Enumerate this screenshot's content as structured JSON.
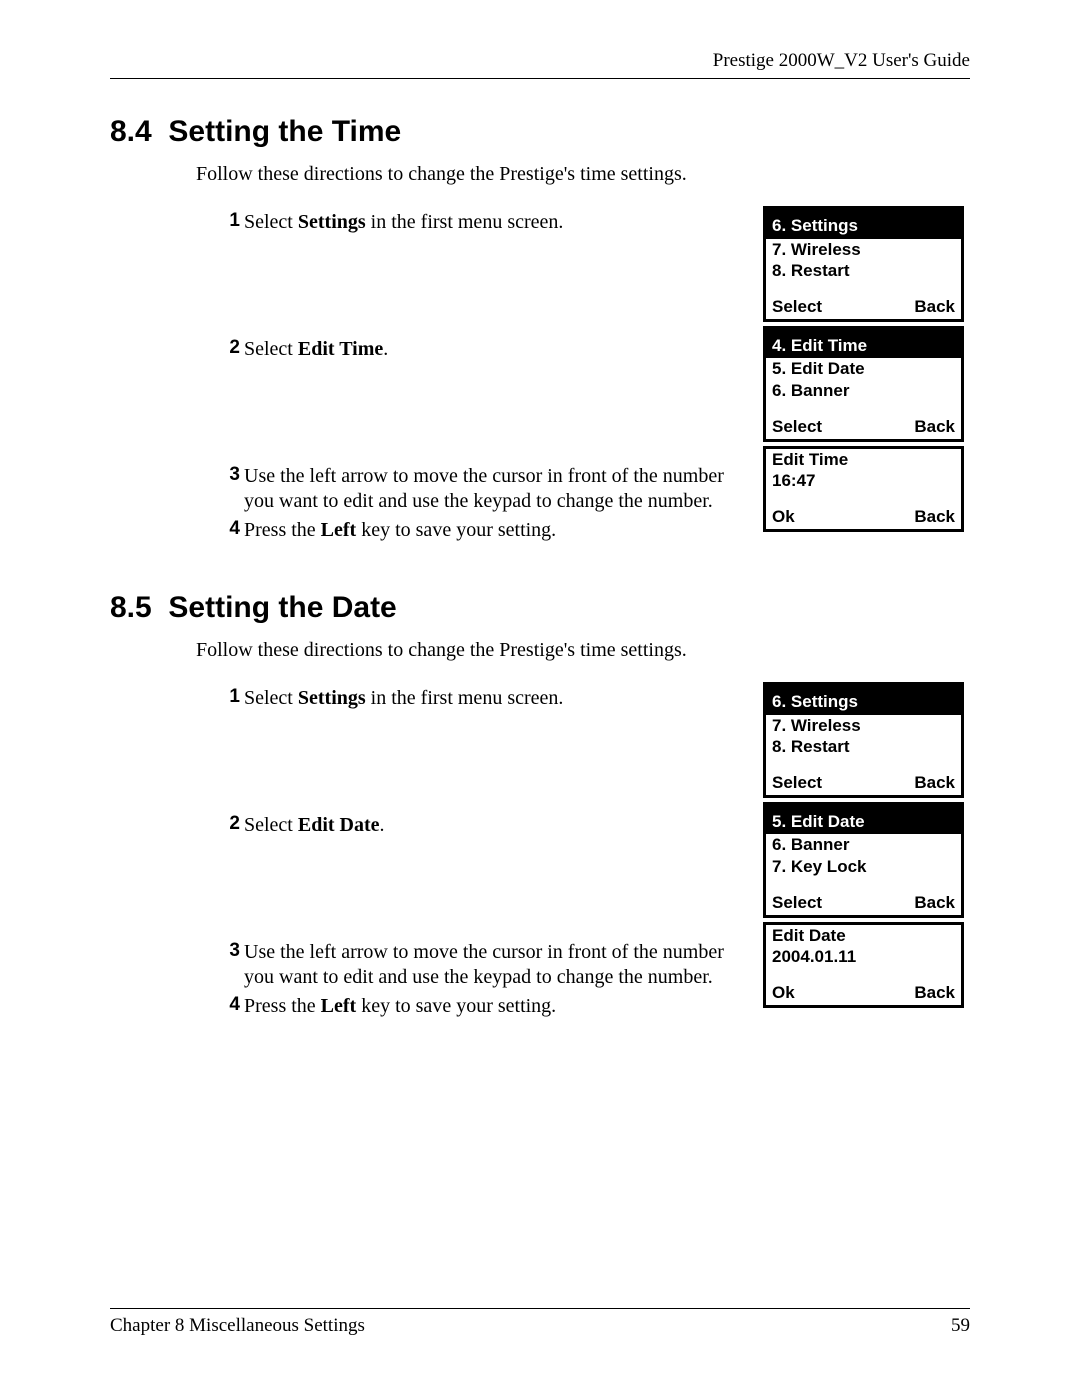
{
  "header": {
    "doc_title": "Prestige 2000W_V2 User's Guide"
  },
  "section_a": {
    "number": "8.4",
    "title": "Setting the Time",
    "intro": "Follow these directions to change the Prestige's time settings.",
    "steps": {
      "n1": "1",
      "s1_pre": "Select ",
      "s1_bold": "Settings",
      "s1_post": " in the first menu screen.",
      "n2": "2",
      "s2_pre": "Select ",
      "s2_bold": "Edit Time",
      "s2_post": ".",
      "n3": "3",
      "s3": "Use the left arrow to move the cursor in front of the number you want to edit and use the keypad to change the number.",
      "n4": "4",
      "s4_pre": "Press the ",
      "s4_bold": "Left",
      "s4_post": " key to save your setting."
    },
    "screen1": {
      "title": "6. Settings",
      "row1": "7. Wireless",
      "row2": "8. Restart",
      "soft_left": "Select",
      "soft_right": "Back"
    },
    "screen2": {
      "title": "4. Edit Time",
      "row1": "5. Edit Date",
      "row2": "6. Banner",
      "soft_left": "Select",
      "soft_right": "Back"
    },
    "screen3": {
      "row1": "Edit Time",
      "row2": "16:47",
      "soft_left": "Ok",
      "soft_right": "Back"
    }
  },
  "section_b": {
    "number": "8.5",
    "title": "Setting the Date",
    "intro": "Follow these directions to change the Prestige's time settings.",
    "steps": {
      "n1": "1",
      "s1_pre": "Select ",
      "s1_bold": "Settings",
      "s1_post": " in the first menu screen.",
      "n2": "2",
      "s2_pre": "Select ",
      "s2_bold": "Edit Date",
      "s2_post": ".",
      "n3": "3",
      "s3": "Use the left arrow to move the cursor in front of the number you want to edit and use the keypad to change the number.",
      "n4": "4",
      "s4_pre": "Press the ",
      "s4_bold": "Left",
      "s4_post": " key to save your setting."
    },
    "screen1": {
      "title": "6. Settings",
      "row1": "7. Wireless",
      "row2": "8. Restart",
      "soft_left": "Select",
      "soft_right": "Back"
    },
    "screen2": {
      "title": "5. Edit Date",
      "row1": "6. Banner",
      "row2": "7. Key Lock",
      "soft_left": "Select",
      "soft_right": "Back"
    },
    "screen3": {
      "row1": "Edit Date",
      "row2": "2004.01.11",
      "soft_left": "Ok",
      "soft_right": "Back"
    }
  },
  "footer": {
    "chapter": "Chapter 8 Miscellaneous Settings",
    "page": "59"
  }
}
